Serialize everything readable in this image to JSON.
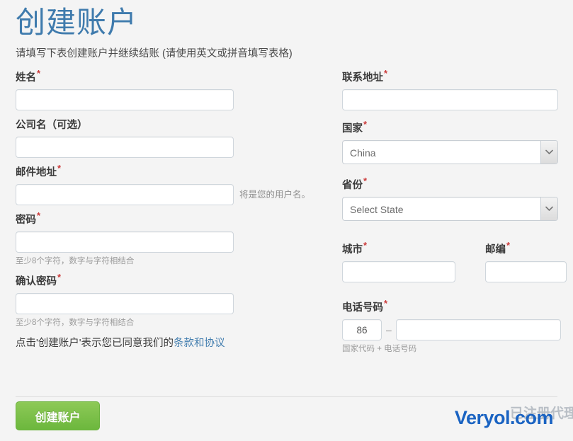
{
  "header": {
    "title": "创建账户",
    "subtitle": "请填写下表创建账户并继续结账 (请使用英文或拼音填写表格)",
    "title_color": "#3f7bad"
  },
  "form": {
    "left": {
      "name": {
        "label": "姓名",
        "required_mark": "*",
        "value": "",
        "placeholder": ""
      },
      "company": {
        "label": "公司名（可选）",
        "required_mark": "",
        "value": "",
        "placeholder": ""
      },
      "email": {
        "label": "邮件地址",
        "required_mark": "*",
        "value": "",
        "placeholder": "",
        "inline_help": "将是您的用户名。"
      },
      "password": {
        "label": "密码",
        "required_mark": "*",
        "value": "",
        "placeholder": "",
        "help": "至少8个字符，数字与字符相结合"
      },
      "confirm_password": {
        "label": "确认密码",
        "required_mark": "*",
        "value": "",
        "placeholder": "",
        "help": "至少8个字符，数字与字符相结合"
      }
    },
    "right": {
      "address": {
        "label": "联系地址",
        "required_mark": "*",
        "value": "",
        "placeholder": ""
      },
      "country": {
        "label": "国家",
        "required_mark": "*",
        "selected": "China",
        "icon": "chevron-down-icon"
      },
      "state": {
        "label": "省份",
        "required_mark": "*",
        "selected": "Select State",
        "icon": "chevron-down-icon"
      },
      "city": {
        "label": "城市",
        "required_mark": "*",
        "value": "",
        "placeholder": ""
      },
      "zip": {
        "label": "邮编",
        "required_mark": "*",
        "value": "",
        "placeholder": ""
      },
      "phone": {
        "label": "电话号码",
        "required_mark": "*",
        "country_code": "86",
        "separator": "–",
        "number": "",
        "placeholder": "",
        "help": "国家代码 + 电话号码"
      }
    }
  },
  "terms": {
    "prefix": "点击'创建账户'表示您已同意我们的",
    "link_label": "条款和协议",
    "link_color": "#3f7bad"
  },
  "footer": {
    "submit_label": "创建账户",
    "submit_color": "#6cb73d"
  },
  "watermark": {
    "brand": "Veryol.com",
    "tagline": "已注册代理",
    "brand_color": "#1a63c2"
  }
}
